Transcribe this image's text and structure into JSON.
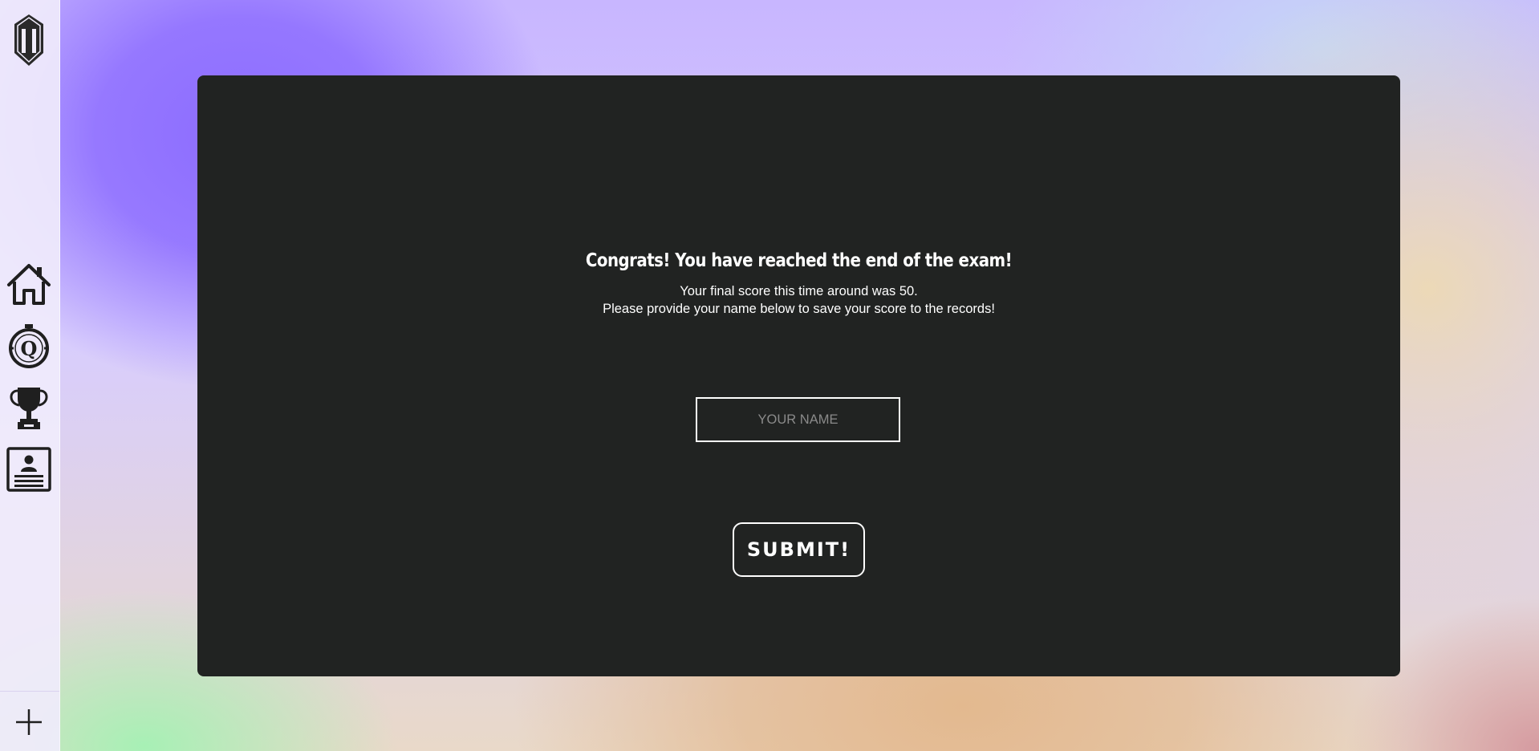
{
  "sidebar": {
    "logo": "shield-logo",
    "items": [
      {
        "icon": "home-icon",
        "label": "Home"
      },
      {
        "icon": "quiz-stopwatch-icon",
        "label": "Quiz"
      },
      {
        "icon": "trophy-icon",
        "label": "High scores"
      },
      {
        "icon": "profile-card-icon",
        "label": "Profile"
      }
    ],
    "add_icon": "plus-icon"
  },
  "panel": {
    "title": "Congrats! You have reached the end of the exam!",
    "score_line": "Your final score this time around was 50.",
    "instruction_line": "Please provide your name below to save your score to the records!",
    "name_placeholder": "YOUR NAME",
    "name_value": "",
    "submit_label": "SUBMIT!"
  },
  "colors": {
    "panel_background": "#212322",
    "text": "#ffffff",
    "placeholder": "#8a8a8a",
    "icon": "#1f1f1f"
  }
}
